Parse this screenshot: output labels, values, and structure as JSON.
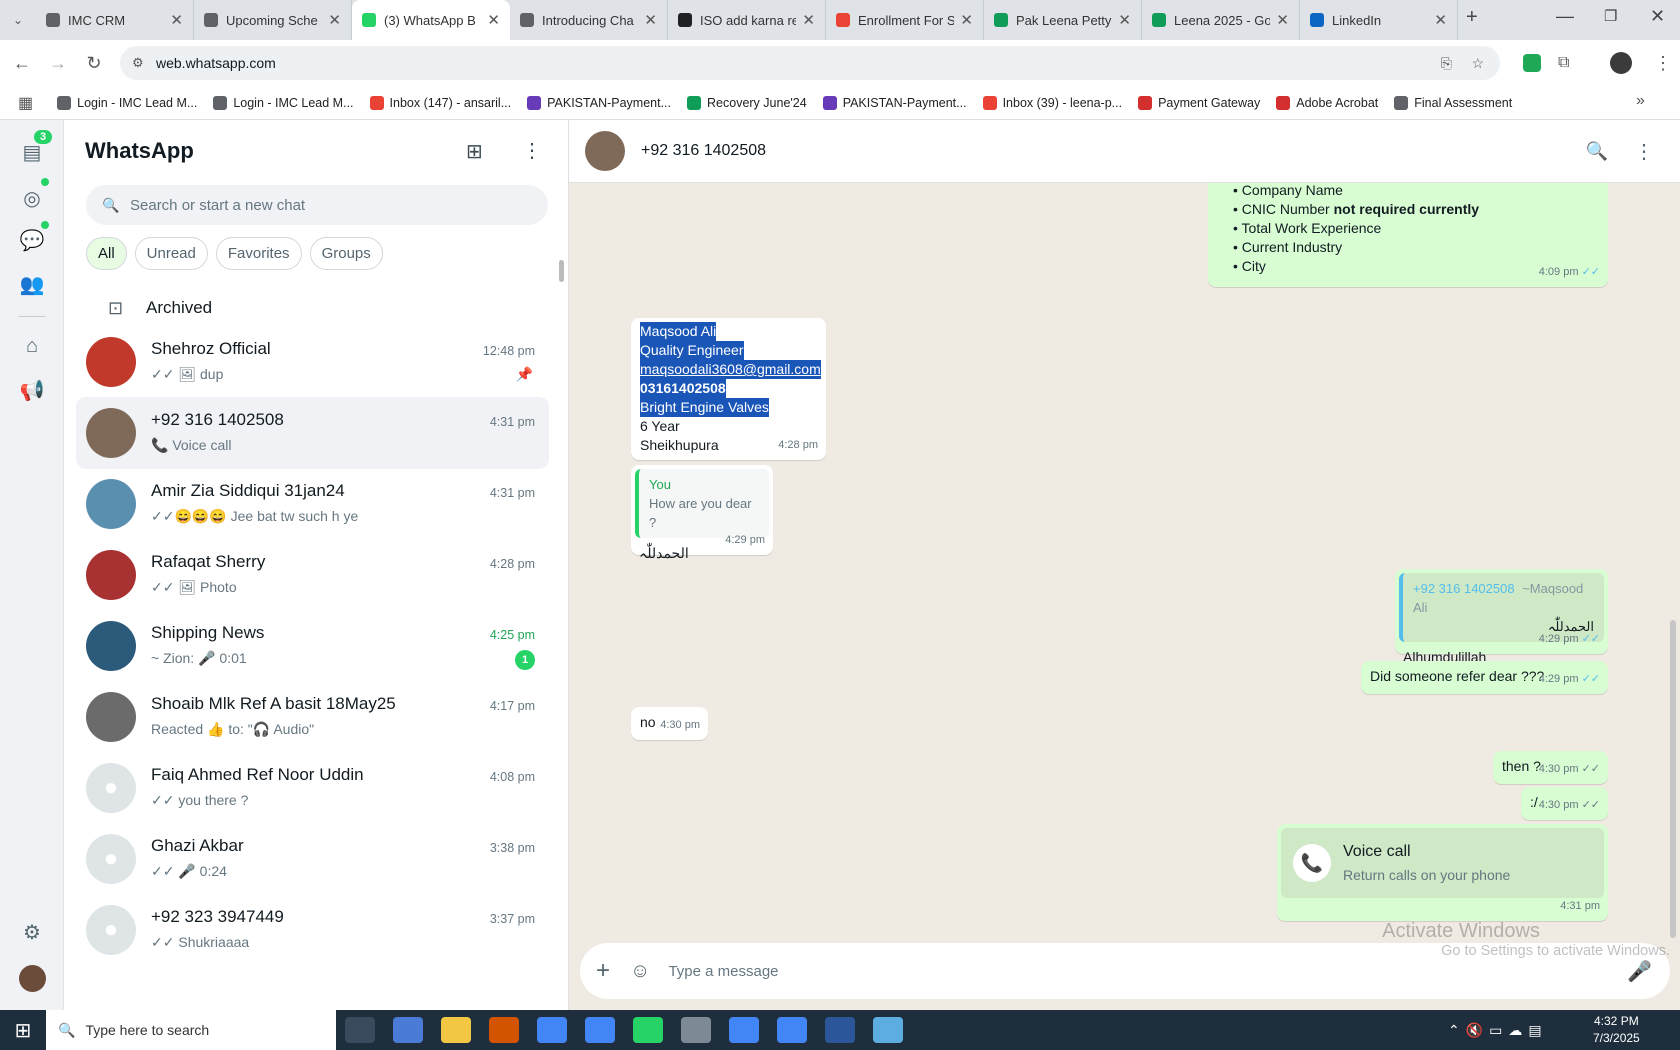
{
  "browser": {
    "tabs": [
      {
        "title": "IMC CRM",
        "color": "#5f6368"
      },
      {
        "title": "Upcoming Sche",
        "color": "#5f6368"
      },
      {
        "title": "(3) WhatsApp B",
        "color": "#25d366",
        "active": true
      },
      {
        "title": "Introducing Cha",
        "color": "#5f6368"
      },
      {
        "title": "ISO add karna re",
        "color": "#202124"
      },
      {
        "title": "Enrollment For S",
        "color": "#ea4335"
      },
      {
        "title": "Pak Leena Petty",
        "color": "#0f9d58"
      },
      {
        "title": "Leena 2025 - Go",
        "color": "#0f9d58"
      },
      {
        "title": "LinkedIn",
        "color": "#0a66c2"
      }
    ],
    "url": "web.whatsapp.com",
    "bookmarks": [
      {
        "label": "Login - IMC Lead M...",
        "color": "#5f6368"
      },
      {
        "label": "Login - IMC Lead M...",
        "color": "#5f6368"
      },
      {
        "label": "Inbox (147) - ansaril...",
        "color": "#ea4335"
      },
      {
        "label": "PAKISTAN-Payment...",
        "color": "#673ab7"
      },
      {
        "label": "Recovery June'24",
        "color": "#0f9d58"
      },
      {
        "label": "PAKISTAN-Payment...",
        "color": "#673ab7"
      },
      {
        "label": "Inbox (39) - leena-p...",
        "color": "#ea4335"
      },
      {
        "label": "Payment Gateway",
        "color": "#d32f2f"
      },
      {
        "label": "Adobe Acrobat",
        "color": "#d32f2f"
      },
      {
        "label": "Final Assessment",
        "color": "#5f6368"
      }
    ]
  },
  "rail": {
    "chats_badge": "3"
  },
  "sidebar": {
    "title": "WhatsApp",
    "search_placeholder": "Search or start a new chat",
    "filters": [
      "All",
      "Unread",
      "Favorites",
      "Groups"
    ],
    "archived": "Archived",
    "chats": [
      {
        "name": "Shehroz Official",
        "msg": "✓✓ 🖼 dup",
        "time": "12:48 pm",
        "pinned": true,
        "color": "#c0392b"
      },
      {
        "name": "+92 316 1402508",
        "msg": "📞 Voice call",
        "time": "4:31 pm",
        "color": "#7f6a5a",
        "selected": true
      },
      {
        "name": "Amir Zia Siddiqui 31jan24",
        "msg": "✓✓😄😄😄 Jee bat tw such h ye",
        "time": "4:31 pm",
        "color": "#5b8fb0"
      },
      {
        "name": "Rafaqat Sherry",
        "msg": "✓✓ 🖼 Photo",
        "time": "4:28 pm",
        "color": "#a83232"
      },
      {
        "name": "Shipping News",
        "msg": "~ Zion: 🎤 0:01",
        "time": "4:25 pm",
        "unread": "1",
        "color": "#2c5a7a"
      },
      {
        "name": "Shoaib Mlk Ref A basit 18May25",
        "msg": "Reacted 👍 to: \"🎧 Audio\"",
        "time": "4:17 pm",
        "color": "#6b6b6b"
      },
      {
        "name": "Faiq Ahmed Ref Noor Uddin",
        "msg": "✓✓ you there ?",
        "time": "4:08 pm",
        "color": "#dfe5e7"
      },
      {
        "name": "Ghazi Akbar",
        "msg": "✓✓ 🎤 0:24",
        "time": "3:38 pm",
        "color": "#dfe5e7"
      },
      {
        "name": "+92 323 3947449",
        "msg": "✓✓ Shukriaaaa",
        "time": "3:37 pm",
        "color": "#dfe5e7"
      }
    ]
  },
  "conversation": {
    "contact": "+92 316 1402508",
    "list_lines": [
      "• Company Name",
      "• CNIC Number ",
      "not required currently",
      "• Total Work Experience",
      "• Current Industry",
      "• City"
    ],
    "list_time": "4:09 pm",
    "card_lines": [
      "Maqsood Ali",
      "Quality Engineer",
      "maqsoodali3608@gmail.com",
      "03161402508",
      "Bright Engine Valves",
      "6 Year",
      "Sheikhupura"
    ],
    "card_time": "4:28 pm",
    "reply_quote_author": "You",
    "reply_quote_text": "How are you dear ?",
    "reply_text": "الحمدللّٰہ",
    "reply_time": "4:29 pm",
    "out_quote_author": "+92 316 1402508",
    "out_quote_name": "~Maqsood Ali",
    "out_quote_text": "الحمدللّٰہ",
    "out_reply_text": "Alhumdulillah",
    "out_reply_time": "4:29 pm",
    "refer_text": "Did someone refer dear ???",
    "refer_time": "4:29 pm",
    "no_text": "no",
    "no_time": "4:30 pm",
    "then_text": "then ?",
    "then_time": "4:30 pm",
    "smile_text": ":/",
    "smile_time": "4:30 pm",
    "call_title": "Voice call",
    "call_sub": "Return calls on your phone",
    "call_time": "4:31 pm",
    "watermark1": "Activate Windows",
    "watermark2": "Go to Settings to activate Windows.",
    "compose_placeholder": "Type a message"
  },
  "taskbar": {
    "search": "Type here to search",
    "time": "4:32 PM",
    "date": "7/3/2025"
  }
}
